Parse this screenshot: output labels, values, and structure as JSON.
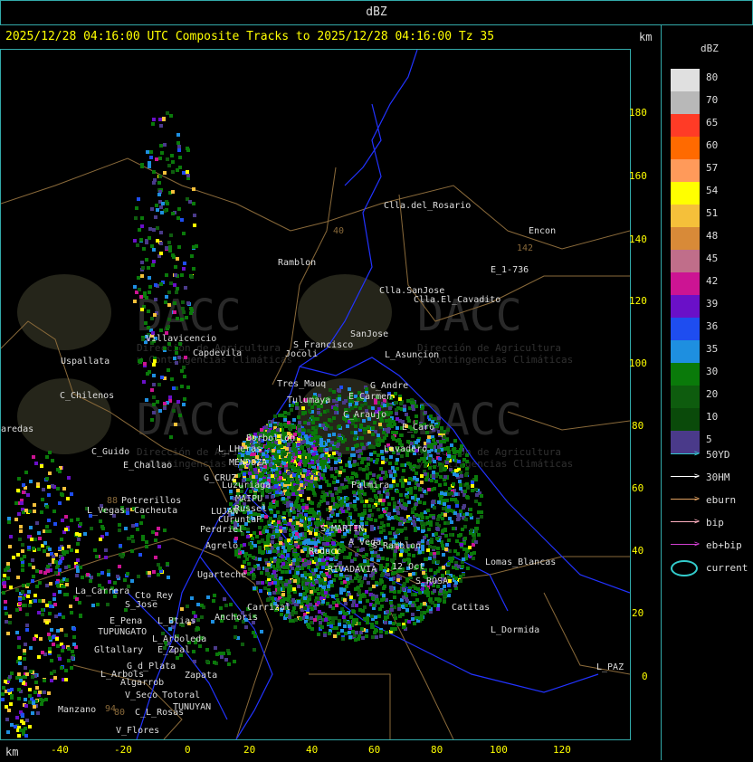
{
  "header": {
    "title": "dBZ"
  },
  "subtitle": "2025/12/28 04:16:00 UTC Composite Tracks to 2025/12/28 04:16:00 Tz 35",
  "units": {
    "top": "km",
    "bottom": "km"
  },
  "axes": {
    "y_ticks": [
      "180",
      "160",
      "140",
      "120",
      "100",
      "80",
      "60",
      "40",
      "20",
      "0"
    ],
    "x_ticks": [
      "-40",
      "-20",
      "0",
      "20",
      "40",
      "60",
      "80",
      "100",
      "120"
    ]
  },
  "legend": {
    "title": "dBZ",
    "levels": [
      {
        "label": "80",
        "color": "#e0e0e0"
      },
      {
        "label": "70",
        "color": "#b8b8b8"
      },
      {
        "label": "65",
        "color": "#ff3b26"
      },
      {
        "label": "60",
        "color": "#ff6a00"
      },
      {
        "label": "57",
        "color": "#ff9a5a"
      },
      {
        "label": "54",
        "color": "#ffff00"
      },
      {
        "label": "51",
        "color": "#f5c03a"
      },
      {
        "label": "48",
        "color": "#d88a38"
      },
      {
        "label": "45",
        "color": "#c06e8a"
      },
      {
        "label": "42",
        "color": "#cc1493"
      },
      {
        "label": "39",
        "color": "#6a10c8"
      },
      {
        "label": "36",
        "color": "#1e4df0"
      },
      {
        "label": "35",
        "color": "#1e8fe0"
      },
      {
        "label": "30",
        "color": "#0a7a0a"
      },
      {
        "label": "20",
        "color": "#0e5c0e"
      },
      {
        "label": "10",
        "color": "#0a4a0a"
      },
      {
        "label": "5",
        "color": "#4a3a8a"
      }
    ]
  },
  "tracks": [
    {
      "label": "50YD",
      "color": "#33cccc"
    },
    {
      "label": "30HM",
      "color": "#ffffff"
    },
    {
      "label": "eburn",
      "color": "#e0a060"
    },
    {
      "label": "bip",
      "color": "#ffb0c0"
    },
    {
      "label": "eb+bip",
      "color": "#d040d0"
    },
    {
      "label": "current",
      "color": "#33cccc"
    }
  ],
  "watermark": {
    "name": "DACC",
    "line1": "Dirección de Agricultura",
    "line2": "y Contingencias Climáticas"
  },
  "places": [
    "Clla.del_Rosario",
    "Encon",
    "142",
    "E_1-736",
    "Ramblon",
    "Clla.SanJose",
    "Clla.El_Cavadito",
    "Villavicencio",
    "Capdevila",
    "S_Francisco",
    "SanJose",
    "L_Asuncion",
    "Jocoli",
    "Uspallata",
    "Tres_Mauq",
    "G_Andre",
    "Tulumaya",
    "E_Carmen",
    "C_Chilenos",
    "C_Araujo",
    "aredas",
    "E_Caro",
    "Borbollon",
    "C_Guido",
    "L_LHeras",
    "Lavadero",
    "E_Challao",
    "MENDOZA",
    "G_CRUZ",
    "Luzuriaga",
    "Palmira",
    "MAIPU",
    "Russel",
    "Potrerillos",
    "L_Vegas",
    "Cacheuta",
    "LUJAN",
    "CUruntaP",
    "Perdriel",
    "S_MARTIN",
    "Agrelo",
    "A_Vega",
    "Reducc",
    "S_Ramblon",
    "RIVADAVIA",
    "Ugarteche",
    "12_Oct",
    "S_ROSA",
    "Lomas_Blancas",
    "La_Carrera",
    "Cto_Rey",
    "S_Jose",
    "Carrizal",
    "Catitas",
    "E_Pena",
    "TUPUNGATO",
    "L_Btias",
    "Anchoris",
    "L_Dormida",
    "L_Arboleda",
    "Gltallary",
    "E_Zpal",
    "G_d_Plata",
    "L_Arbols",
    "Algarrob",
    "Zapata",
    "V_Seco",
    "Totoral",
    "TUNUYAN",
    "Manzano",
    "94",
    "C_L_Rosas",
    "V_Flores",
    "L_PAZ",
    "40",
    "88",
    "80"
  ]
}
